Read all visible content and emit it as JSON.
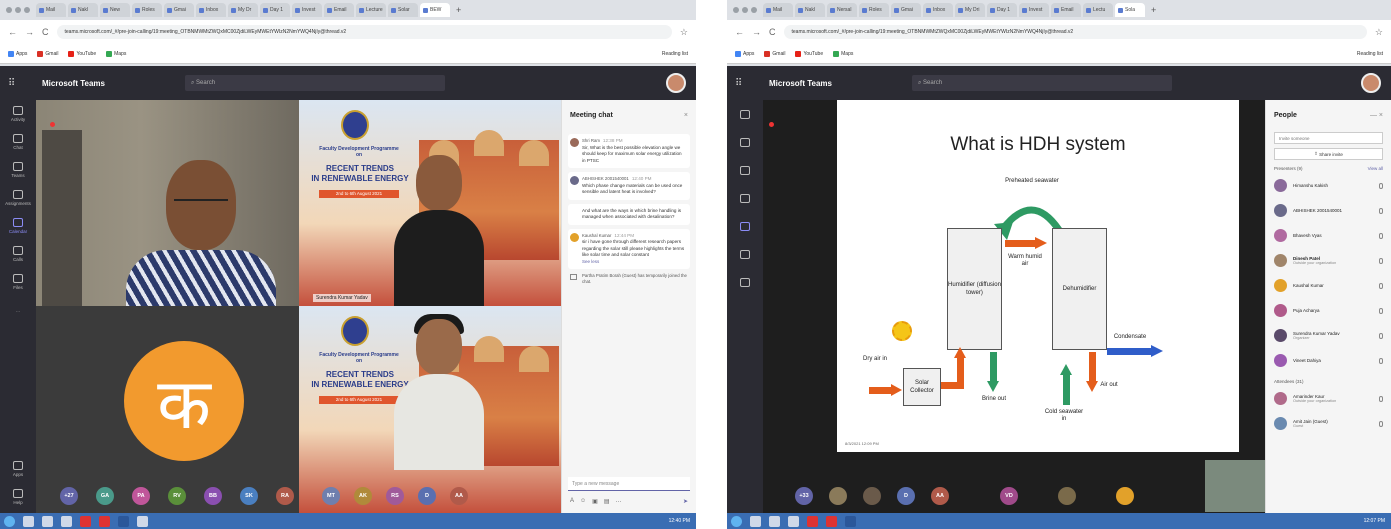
{
  "left": {
    "tabs": [
      "Mail",
      "Nakl",
      "New",
      "Roles",
      "Gmai",
      "Inbox",
      "My Dr",
      "Day 1",
      "Invest",
      "Email",
      "Lecture",
      "Solar",
      "BEW"
    ],
    "url": "teams.microsoft.com/_#/pre-join-calling/19:meeting_OTBNMWMtZWQxMC00ZjdiLWEyMWEtYWIzN2NmYWQ4NjIy@thread.v2",
    "bookmarks": [
      "Apps",
      "Gmail",
      "YouTube",
      "Maps"
    ],
    "reading_list": "Reading list",
    "brand": "Microsoft Teams",
    "search_placeholder": "Search",
    "rail": [
      "Activity",
      "Chat",
      "Teams",
      "Assignments",
      "Calendar",
      "Calls",
      "Files",
      "...",
      "Apps",
      "Help"
    ],
    "poster": {
      "fdp": "Faculty Development Programme",
      "on": "on",
      "title_line1": "RECENT TRENDS",
      "title_line2": "IN RENEWABLE ENERGY",
      "dates": "2nd to 6th August 2021"
    },
    "speaker1_name": "Surendra Kumar Yadav",
    "participants_bar": [
      "+27",
      "GA",
      "PA",
      "RV",
      "BB",
      "SK",
      "RA"
    ],
    "participants_bar2": [
      "MT",
      "AK",
      "RS",
      "D",
      "AA"
    ],
    "chat": {
      "title": "Meeting chat",
      "close": "×",
      "messages": [
        {
          "who": "Shri Ram",
          "time": "12:38 PM",
          "text": "Sir, What is the best possible elevation angle we should keep for maximum solar energy utilization in PTSC"
        },
        {
          "who": "ABHISHEK 2001540001",
          "time": "12:40 PM",
          "text": "Which phase change materials can be used once sensible and latent heat is involved?"
        },
        {
          "who": "",
          "time": "",
          "text": "And what are the ways in which brine handling is managed when associated with desalination?"
        },
        {
          "who": "Kaushal Kumar",
          "time": "12:44 PM",
          "text": "sir i have gone through different research papers regarding the solar still please highlights the terms like solar time and solar constant"
        }
      ],
      "see_less": "See less",
      "system": "Partha Pratim Borah (Guest) has temporarily joined the chat.",
      "compose_placeholder": "Type a new message"
    },
    "clock": "12:40 PM"
  },
  "right": {
    "tabs": [
      "Mail",
      "Nakl",
      "Nersal",
      "Roles",
      "Gmai",
      "Inbox",
      "My Dri",
      "Day 1",
      "Invest",
      "Email",
      "Lectu",
      "Sola"
    ],
    "url": "teams.microsoft.com/_#/pre-join-calling/19:meeting_OTBNMWMtZWQxMC00ZjdiLWEyMWEtYWIzN2NmYWQ4NjIy@thread.v2",
    "bookmarks": [
      "Apps",
      "Gmail",
      "YouTube",
      "Maps"
    ],
    "reading_list": "Reading list",
    "brand": "Microsoft Teams",
    "search_placeholder": "Search",
    "slide": {
      "title": "What is HDH system",
      "preheated": "Preheated seawater",
      "warm": "Warm humid air",
      "humidifier": "Humidifier (diffusion tower)",
      "dehumidifier": "Dehumidifier",
      "dry_air": "Dry air in",
      "collector": "Solar Collector",
      "brine": "Brine out",
      "cold": "Cold seawater in",
      "air_out": "Air out",
      "condensate": "Condensate",
      "date": "8/3/2021 12:09 PM"
    },
    "participants_bar": [
      "+33",
      "D",
      "AA",
      "VD"
    ],
    "people": {
      "title": "People",
      "invite_placeholder": "Invite someone",
      "share": "Share invite",
      "presenters": "Presenters (9)",
      "view_all": "View all",
      "list": [
        {
          "name": "Himanshu Kakish",
          "sub": ""
        },
        {
          "name": "ABHISHEK 2001540001",
          "sub": ""
        },
        {
          "name": "Bhavesh Vyas",
          "sub": ""
        },
        {
          "name": "Dinesh Patel",
          "sub": "Outside your organization"
        },
        {
          "name": "Kaushal Kumar",
          "sub": ""
        },
        {
          "name": "Puja Acharya",
          "sub": ""
        },
        {
          "name": "Surendra Kumar Yadav",
          "sub": "Organizer"
        },
        {
          "name": "Vineet Dahiya",
          "sub": ""
        }
      ],
      "attendees": "Attendees (31)",
      "attendee_list": [
        {
          "name": "Amarinder Kaur",
          "sub": "Outside your organization"
        },
        {
          "name": "Amit Jain (Guest)",
          "sub": "Guest"
        }
      ]
    },
    "clock": "12:07 PM"
  },
  "colors": {
    "teams_dark": "#2b2b33",
    "accent": "#6264a7",
    "orange": "#e45d1b",
    "green": "#2e9a63",
    "blue": "#2f5dc9"
  }
}
